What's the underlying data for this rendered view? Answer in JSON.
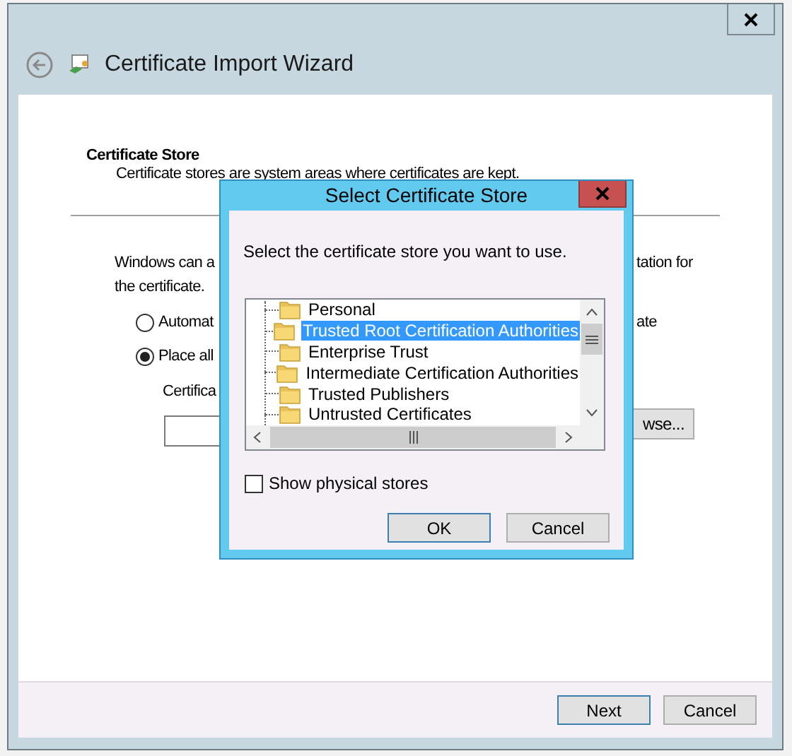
{
  "wizard": {
    "title": "Certificate Import Wizard",
    "heading": "Certificate Store",
    "description": "Certificate stores are system areas where certificates are kept.",
    "intro_line_start": "Windows can a",
    "intro_line_end": "tation for",
    "intro_line_2": "the certificate.",
    "options": [
      {
        "label_start": "Automat",
        "label_end": "ate",
        "selected": false
      },
      {
        "label_start": "Place all",
        "selected": true
      }
    ],
    "store_label": "Certifica",
    "browse_button": "wse...",
    "buttons": [
      {
        "label": "Next",
        "default": true
      },
      {
        "label": "Cancel",
        "default": false
      }
    ]
  },
  "dialog": {
    "title": "Select Certificate Store",
    "prompt": "Select the certificate store you want to use.",
    "stores": [
      {
        "label": "Personal",
        "selected": false
      },
      {
        "label": "Trusted Root Certification Authorities",
        "selected": true
      },
      {
        "label": "Enterprise Trust",
        "selected": false
      },
      {
        "label": "Intermediate Certification Authorities",
        "selected": false
      },
      {
        "label": "Trusted Publishers",
        "selected": false
      },
      {
        "label": "Untrusted Certificates",
        "selected": false
      }
    ],
    "checkbox": {
      "label": "Show physical stores",
      "checked": false
    },
    "buttons": [
      {
        "label": "OK",
        "default": true
      },
      {
        "label": "Cancel",
        "default": false
      }
    ]
  }
}
